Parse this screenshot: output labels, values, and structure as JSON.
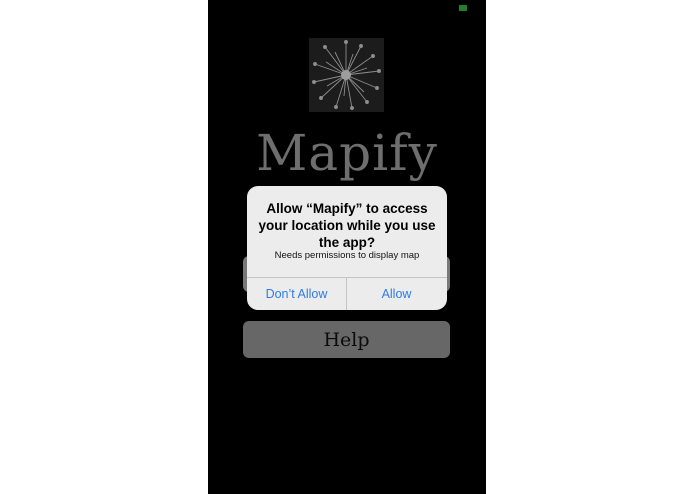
{
  "status_bar": {
    "battery_color": "#3bbf4a"
  },
  "app": {
    "logo_icon": "starburst-logo-icon",
    "title": "Mapify",
    "help_label": "Help"
  },
  "alert": {
    "title": "Allow “Mapify” to access your location while you use the app?",
    "message": "Needs permissions to display map",
    "deny_label": "Don’t Allow",
    "allow_label": "Allow",
    "button_color": "#2e7bea"
  }
}
